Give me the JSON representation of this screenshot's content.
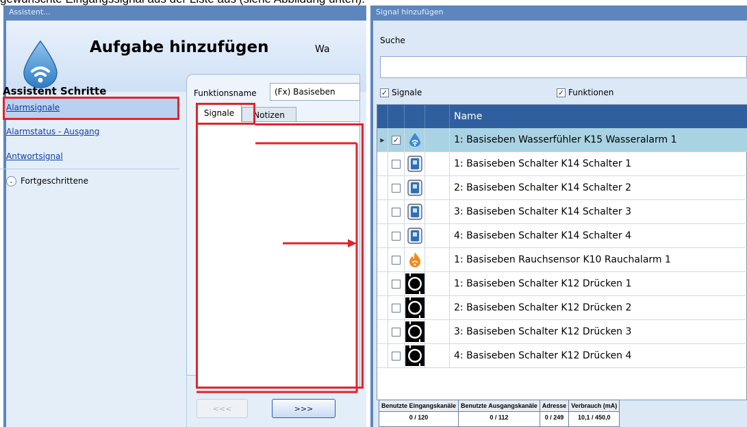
{
  "caption": "gewünschte Eingangssignal aus der Liste aus (siehe Abbildung unten).",
  "left_window": {
    "title": "Assistent...",
    "header": {
      "title": "Aufgabe hinzufügen",
      "extra": "Wa"
    },
    "steps_title": "Assistent Schritte",
    "steps": [
      "Alarmsignale",
      "Alarmstatus - Ausgang",
      "Antwortsignal"
    ],
    "advanced_label": "Fortgeschrittene",
    "function_name_label": "Funktionsname",
    "function_name_value": "(Fx) Basiseben",
    "tabs": [
      "Signale",
      "Notizen"
    ],
    "back_button": "<<<",
    "next_button": ">>>"
  },
  "right_window": {
    "title": "Signal hinzufügen",
    "search_label": "Suche",
    "search_value": "",
    "filter_signale": {
      "label": "Signale",
      "checked": true
    },
    "filter_funktionen": {
      "label": "Funktionen",
      "checked": true
    },
    "column_name": "Name",
    "rows": [
      {
        "name": "1: Basiseben Wasserfühler K15 Wasseralarm 1",
        "icon": "water-drop-icon",
        "checked": true,
        "selected": true
      },
      {
        "name": "1: Basiseben Schalter K14 Schalter 1",
        "icon": "switch-icon",
        "checked": false,
        "selected": false
      },
      {
        "name": "2: Basiseben Schalter K14 Schalter 2",
        "icon": "switch-icon",
        "checked": false,
        "selected": false
      },
      {
        "name": "3: Basiseben Schalter K14 Schalter 3",
        "icon": "switch-icon",
        "checked": false,
        "selected": false
      },
      {
        "name": "4: Basiseben Schalter K14 Schalter 4",
        "icon": "switch-icon",
        "checked": false,
        "selected": false
      },
      {
        "name": "1: Basiseben Rauchsensor K10 Rauchalarm 1",
        "icon": "fire-icon",
        "checked": false,
        "selected": false
      },
      {
        "name": "1: Basiseben Schalter K12 Drücken 1",
        "icon": "push-button-icon",
        "checked": false,
        "selected": false
      },
      {
        "name": "2: Basiseben Schalter K12 Drücken 2",
        "icon": "push-button-icon",
        "checked": false,
        "selected": false
      },
      {
        "name": "3: Basiseben Schalter K12 Drücken 3",
        "icon": "push-button-icon",
        "checked": false,
        "selected": false
      },
      {
        "name": "4: Basiseben Schalter K12 Drücken 4",
        "icon": "push-button-icon",
        "checked": false,
        "selected": false
      }
    ],
    "stats": [
      {
        "label": "Benutzte Eingangskanäle",
        "value": "0 / 120"
      },
      {
        "label": "Benutzte Ausgangskanäle",
        "value": "0 / 112"
      },
      {
        "label": "Adresse",
        "value": "0 / 249"
      },
      {
        "label": "Verbrauch (mA)",
        "value": "10,1 / 450,0"
      }
    ]
  },
  "colors": {
    "highlight": "#e0232b",
    "window_frame": "#5d86bd",
    "grid_header": "#2f5f9e",
    "selected_row": "#a9d3e3"
  }
}
